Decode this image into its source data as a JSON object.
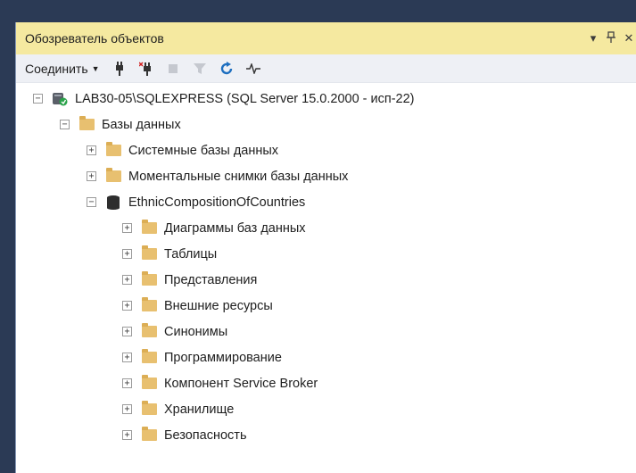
{
  "panel": {
    "title": "Обозреватель объектов",
    "controls": {
      "dropdown": "▾",
      "pin": "⊥",
      "close": "✕"
    }
  },
  "toolbar": {
    "connect_label": "Соединить",
    "icons": [
      "connect-icon",
      "disconnect-icon",
      "stop-icon",
      "filter-icon",
      "refresh-icon",
      "activity-monitor-icon"
    ]
  },
  "tree": {
    "server": "LAB30-05\\SQLEXPRESS (SQL Server 15.0.2000 - исп-22)",
    "databases": "Базы данных",
    "system_dbs": "Системные базы данных",
    "snapshots": "Моментальные снимки базы данных",
    "database": "EthnicCompositionOfCountries",
    "children": [
      "Диаграммы баз данных",
      "Таблицы",
      "Представления",
      "Внешние ресурсы",
      "Синонимы",
      "Программирование",
      "Компонент Service Broker",
      "Хранилище",
      "Безопасность"
    ]
  },
  "colors": {
    "titlebar": "#f5e9a0",
    "toolbar": "#eef0f5",
    "folder": "#e8c070",
    "background": "#2b3a55"
  }
}
